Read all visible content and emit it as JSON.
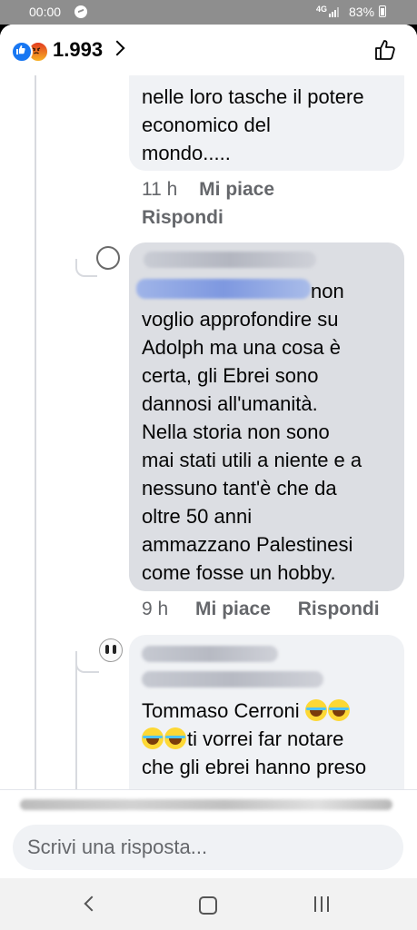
{
  "status_bar": {
    "time": "00:00",
    "network": "4G",
    "battery": "83%"
  },
  "header": {
    "reaction_icons": [
      "like-icon",
      "angry-icon"
    ],
    "reaction_count": "1.993"
  },
  "comments": [
    {
      "text_lines": [
        "nelle loro tasche il potere",
        "economico del",
        "mondo....."
      ],
      "time": "11 h",
      "like_label": "Mi piace",
      "reply_label": "Rispondi"
    },
    {
      "text_after_tag": "non",
      "text_lines": [
        "voglio approfondire su",
        "Adolph ma una cosa è",
        "certa, gli Ebrei sono",
        "dannosi all'umanità.",
        "Nella storia non sono",
        "mai stati utili a niente e a",
        "nessuno tant'è che da",
        "oltre 50 anni",
        "ammazzano Palestinesi",
        "come fosse un hobby."
      ],
      "time": "9 h",
      "like_label": "Mi piace",
      "reply_label": "Rispondi"
    },
    {
      "mention": "Tommaso Cerroni",
      "text_lines": [
        "ti vorrei far notare",
        "che gli ebrei hanno preso"
      ]
    }
  ],
  "reply": {
    "placeholder": "Scrivi una risposta..."
  },
  "colors": {
    "facebook_blue": "#1877f2",
    "bubble_gray": "#f0f2f5",
    "meta_gray": "#65676b"
  }
}
